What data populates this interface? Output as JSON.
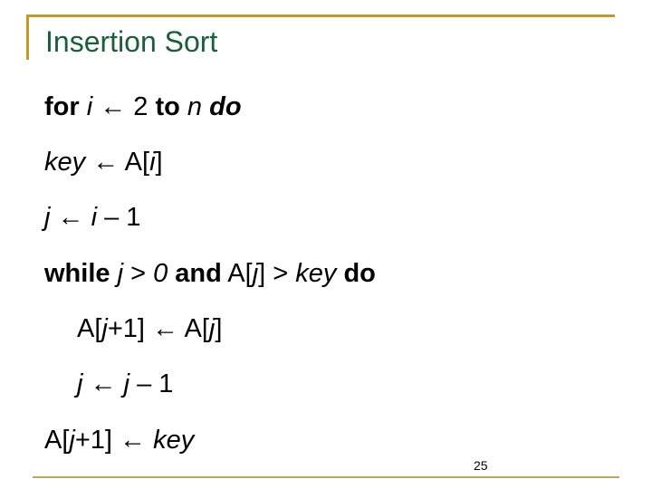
{
  "slide": {
    "title": "Insertion Sort",
    "page_number": "25",
    "colors": {
      "title": "#1a5e3a",
      "accent_rule": "#c49a26",
      "bottom_rule": "#b8a85a",
      "text": "#000000"
    }
  },
  "code": {
    "line1": {
      "kw_for": "for",
      "var_i": "i",
      "arrow": " ← 2 ",
      "kw_to": "to",
      "var_n": " n ",
      "kw_do": "do"
    },
    "line2": {
      "var_key": "key",
      "rest": " ← A[",
      "var_i": "i",
      "close": "]"
    },
    "line3": {
      "var_j": "j",
      "arrow": " ← ",
      "var_i": "i",
      "rest": " – 1"
    },
    "line4": {
      "kw_while": "while",
      "var_j": " j ",
      "gt1": "> ",
      "zero": "0",
      "space": " ",
      "kw_and": "and",
      "a_open": " A[",
      "var_j2": "j",
      "a_close": "] > ",
      "var_key": "key",
      "space2": " ",
      "kw_do": "do"
    },
    "line5": {
      "a_open": "A[",
      "var_j": "j",
      "mid": "+1] ← A[",
      "var_j2": "j",
      "close": "]"
    },
    "line6": {
      "var_j": "j",
      "arrow": " ← ",
      "var_j2": "j",
      "rest": " – 1"
    },
    "line7": {
      "a_open": "A[",
      "var_j": "j",
      "mid": "+1] ← ",
      "var_key": "key"
    }
  }
}
